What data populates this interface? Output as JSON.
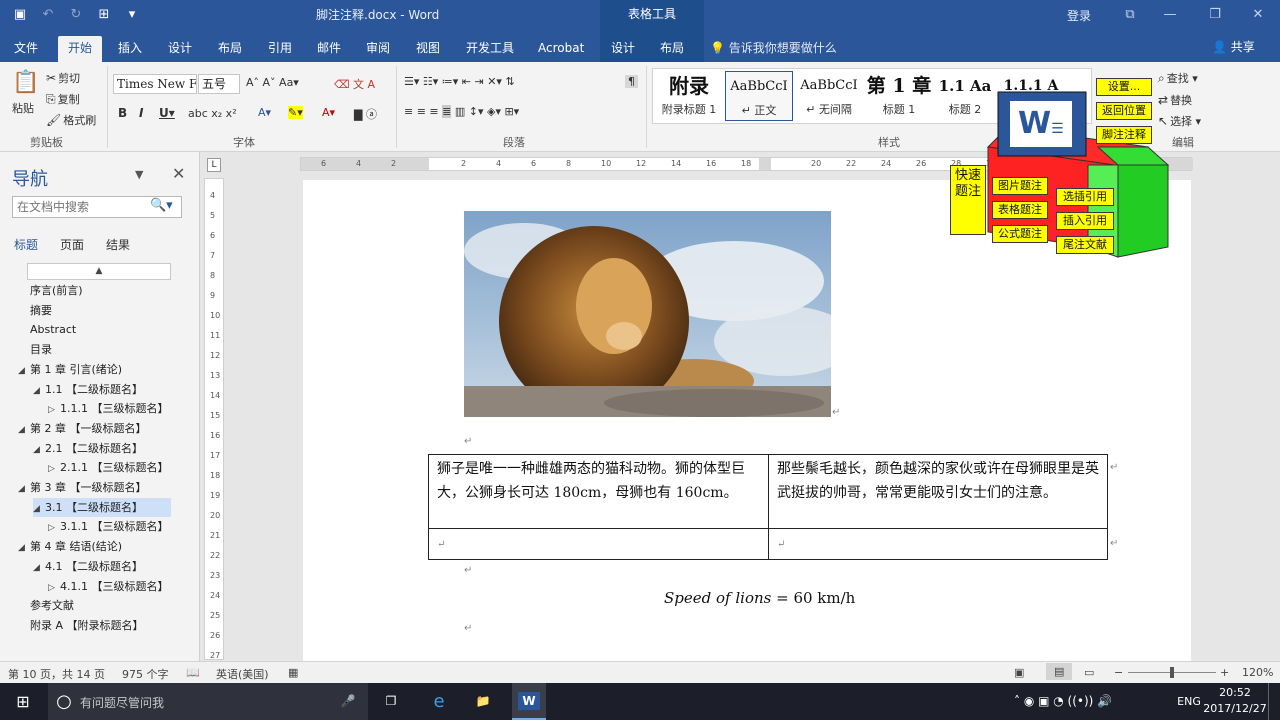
{
  "titlebar": {
    "doc_title": "脚注注释.docx  -  Word",
    "context_title": "表格工具",
    "login": "登录"
  },
  "tabs": [
    {
      "label": "文件"
    },
    {
      "label": "开始"
    },
    {
      "label": "插入"
    },
    {
      "label": "设计"
    },
    {
      "label": "布局"
    },
    {
      "label": "引用"
    },
    {
      "label": "邮件"
    },
    {
      "label": "审阅"
    },
    {
      "label": "视图"
    },
    {
      "label": "开发工具"
    },
    {
      "label": "Acrobat"
    },
    {
      "label": "设计"
    },
    {
      "label": "布局"
    }
  ],
  "tell_me": "告诉我你想要做什么",
  "share": "共享",
  "ribbon": {
    "clipboard": {
      "paste": "粘贴",
      "cut": "剪切",
      "copy": "复制",
      "format_painter": "格式刷",
      "label": "剪贴板"
    },
    "font": {
      "name": "Times New F",
      "size": "五号",
      "label": "字体"
    },
    "paragraph": {
      "label": "段落"
    },
    "styles": {
      "label": "样式",
      "items": [
        {
          "preview": "附录",
          "name": "附录标题 1"
        },
        {
          "preview": "AaBbCcI",
          "name": "↵ 正文"
        },
        {
          "preview": "AaBbCcI",
          "name": "↵ 无间隔"
        },
        {
          "preview": "第 1 章",
          "name": "标题 1"
        },
        {
          "preview": "1.1  Aa",
          "name": "标题 2"
        },
        {
          "preview": "1.1.1  A",
          "name": ""
        }
      ]
    },
    "editing": {
      "find": "查找",
      "replace": "替换",
      "select": "选择",
      "label": "编辑"
    }
  },
  "nav": {
    "title": "导航",
    "search_placeholder": "在文档中搜索",
    "tabs": [
      "标题",
      "页面",
      "结果"
    ],
    "items": [
      {
        "label": "序言(前言)",
        "level": 0,
        "arrow": ""
      },
      {
        "label": "摘要",
        "level": 0,
        "arrow": ""
      },
      {
        "label": "Abstract",
        "level": 0,
        "arrow": ""
      },
      {
        "label": "目录",
        "level": 0,
        "arrow": ""
      },
      {
        "label": "第 1 章 引言(绪论)",
        "level": 0,
        "arrow": "◢"
      },
      {
        "label": "1.1 【二级标题名】",
        "level": 1,
        "arrow": "◢"
      },
      {
        "label": "1.1.1 【三级标题名】",
        "level": 2,
        "arrow": "▷"
      },
      {
        "label": "第 2 章 【一级标题名】",
        "level": 0,
        "arrow": "◢"
      },
      {
        "label": "2.1 【二级标题名】",
        "level": 1,
        "arrow": "◢"
      },
      {
        "label": "2.1.1 【三级标题名】",
        "level": 2,
        "arrow": "▷"
      },
      {
        "label": "第 3 章 【一级标题名】",
        "level": 0,
        "arrow": "◢"
      },
      {
        "label": "3.1 【二级标题名】",
        "level": 1,
        "arrow": "◢",
        "selected": true
      },
      {
        "label": "3.1.1 【三级标题名】",
        "level": 2,
        "arrow": "▷"
      },
      {
        "label": "第 4 章 结语(结论)",
        "level": 0,
        "arrow": "◢"
      },
      {
        "label": "4.1 【二级标题名】",
        "level": 1,
        "arrow": "◢"
      },
      {
        "label": "4.1.1 【三级标题名】",
        "level": 2,
        "arrow": "▷"
      },
      {
        "label": "参考文献",
        "level": 0,
        "arrow": ""
      },
      {
        "label": "附录 A 【附录标题名】",
        "level": 0,
        "arrow": ""
      }
    ]
  },
  "document": {
    "table": {
      "r1c1": "狮子是唯一一种雌雄两态的猫科动物。狮的体型巨大，公狮身长可达 180cm，母狮也有 160cm。",
      "r1c2": "那些鬃毛越长，颜色越深的家伙或许在母狮眼里是英武挺拔的帅哥，常常更能吸引女士们的注意。"
    },
    "formula_italic": "Speed of lions",
    "formula_rest": " = 60 km/h"
  },
  "addin": {
    "settings": "设置...",
    "return": "返回位置",
    "footnote": "脚注注释",
    "quick_caption": "快速题注",
    "figure_caption": "图片题注",
    "table_caption": "表格题注",
    "formula_caption": "公式题注",
    "cross_ref": "选插引用",
    "insert_ref": "插入引用",
    "endnote": "尾注文献",
    "word_letter": "W"
  },
  "status": {
    "page": "第 10 页，共 14 页",
    "words": "975 个字",
    "lang": "英语(美国)",
    "zoom": "120%"
  },
  "taskbar": {
    "cortana": "有问题尽管问我",
    "ime": "ENG",
    "time": "20:52",
    "date": "2017/12/27"
  }
}
